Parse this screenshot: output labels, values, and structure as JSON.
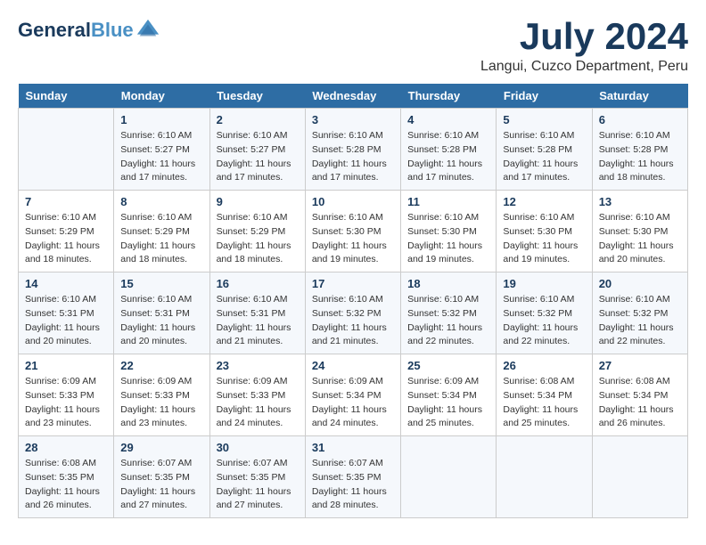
{
  "header": {
    "logo_line1": "General",
    "logo_line2": "Blue",
    "month_year": "July 2024",
    "location": "Langui, Cuzco Department, Peru"
  },
  "days_of_week": [
    "Sunday",
    "Monday",
    "Tuesday",
    "Wednesday",
    "Thursday",
    "Friday",
    "Saturday"
  ],
  "weeks": [
    [
      {
        "day": "",
        "sunrise": "",
        "sunset": "",
        "daylight": ""
      },
      {
        "day": "1",
        "sunrise": "Sunrise: 6:10 AM",
        "sunset": "Sunset: 5:27 PM",
        "daylight": "Daylight: 11 hours and 17 minutes."
      },
      {
        "day": "2",
        "sunrise": "Sunrise: 6:10 AM",
        "sunset": "Sunset: 5:27 PM",
        "daylight": "Daylight: 11 hours and 17 minutes."
      },
      {
        "day": "3",
        "sunrise": "Sunrise: 6:10 AM",
        "sunset": "Sunset: 5:28 PM",
        "daylight": "Daylight: 11 hours and 17 minutes."
      },
      {
        "day": "4",
        "sunrise": "Sunrise: 6:10 AM",
        "sunset": "Sunset: 5:28 PM",
        "daylight": "Daylight: 11 hours and 17 minutes."
      },
      {
        "day": "5",
        "sunrise": "Sunrise: 6:10 AM",
        "sunset": "Sunset: 5:28 PM",
        "daylight": "Daylight: 11 hours and 17 minutes."
      },
      {
        "day": "6",
        "sunrise": "Sunrise: 6:10 AM",
        "sunset": "Sunset: 5:28 PM",
        "daylight": "Daylight: 11 hours and 18 minutes."
      }
    ],
    [
      {
        "day": "7",
        "sunrise": "Sunrise: 6:10 AM",
        "sunset": "Sunset: 5:29 PM",
        "daylight": "Daylight: 11 hours and 18 minutes."
      },
      {
        "day": "8",
        "sunrise": "Sunrise: 6:10 AM",
        "sunset": "Sunset: 5:29 PM",
        "daylight": "Daylight: 11 hours and 18 minutes."
      },
      {
        "day": "9",
        "sunrise": "Sunrise: 6:10 AM",
        "sunset": "Sunset: 5:29 PM",
        "daylight": "Daylight: 11 hours and 18 minutes."
      },
      {
        "day": "10",
        "sunrise": "Sunrise: 6:10 AM",
        "sunset": "Sunset: 5:30 PM",
        "daylight": "Daylight: 11 hours and 19 minutes."
      },
      {
        "day": "11",
        "sunrise": "Sunrise: 6:10 AM",
        "sunset": "Sunset: 5:30 PM",
        "daylight": "Daylight: 11 hours and 19 minutes."
      },
      {
        "day": "12",
        "sunrise": "Sunrise: 6:10 AM",
        "sunset": "Sunset: 5:30 PM",
        "daylight": "Daylight: 11 hours and 19 minutes."
      },
      {
        "day": "13",
        "sunrise": "Sunrise: 6:10 AM",
        "sunset": "Sunset: 5:30 PM",
        "daylight": "Daylight: 11 hours and 20 minutes."
      }
    ],
    [
      {
        "day": "14",
        "sunrise": "Sunrise: 6:10 AM",
        "sunset": "Sunset: 5:31 PM",
        "daylight": "Daylight: 11 hours and 20 minutes."
      },
      {
        "day": "15",
        "sunrise": "Sunrise: 6:10 AM",
        "sunset": "Sunset: 5:31 PM",
        "daylight": "Daylight: 11 hours and 20 minutes."
      },
      {
        "day": "16",
        "sunrise": "Sunrise: 6:10 AM",
        "sunset": "Sunset: 5:31 PM",
        "daylight": "Daylight: 11 hours and 21 minutes."
      },
      {
        "day": "17",
        "sunrise": "Sunrise: 6:10 AM",
        "sunset": "Sunset: 5:32 PM",
        "daylight": "Daylight: 11 hours and 21 minutes."
      },
      {
        "day": "18",
        "sunrise": "Sunrise: 6:10 AM",
        "sunset": "Sunset: 5:32 PM",
        "daylight": "Daylight: 11 hours and 22 minutes."
      },
      {
        "day": "19",
        "sunrise": "Sunrise: 6:10 AM",
        "sunset": "Sunset: 5:32 PM",
        "daylight": "Daylight: 11 hours and 22 minutes."
      },
      {
        "day": "20",
        "sunrise": "Sunrise: 6:10 AM",
        "sunset": "Sunset: 5:32 PM",
        "daylight": "Daylight: 11 hours and 22 minutes."
      }
    ],
    [
      {
        "day": "21",
        "sunrise": "Sunrise: 6:09 AM",
        "sunset": "Sunset: 5:33 PM",
        "daylight": "Daylight: 11 hours and 23 minutes."
      },
      {
        "day": "22",
        "sunrise": "Sunrise: 6:09 AM",
        "sunset": "Sunset: 5:33 PM",
        "daylight": "Daylight: 11 hours and 23 minutes."
      },
      {
        "day": "23",
        "sunrise": "Sunrise: 6:09 AM",
        "sunset": "Sunset: 5:33 PM",
        "daylight": "Daylight: 11 hours and 24 minutes."
      },
      {
        "day": "24",
        "sunrise": "Sunrise: 6:09 AM",
        "sunset": "Sunset: 5:34 PM",
        "daylight": "Daylight: 11 hours and 24 minutes."
      },
      {
        "day": "25",
        "sunrise": "Sunrise: 6:09 AM",
        "sunset": "Sunset: 5:34 PM",
        "daylight": "Daylight: 11 hours and 25 minutes."
      },
      {
        "day": "26",
        "sunrise": "Sunrise: 6:08 AM",
        "sunset": "Sunset: 5:34 PM",
        "daylight": "Daylight: 11 hours and 25 minutes."
      },
      {
        "day": "27",
        "sunrise": "Sunrise: 6:08 AM",
        "sunset": "Sunset: 5:34 PM",
        "daylight": "Daylight: 11 hours and 26 minutes."
      }
    ],
    [
      {
        "day": "28",
        "sunrise": "Sunrise: 6:08 AM",
        "sunset": "Sunset: 5:35 PM",
        "daylight": "Daylight: 11 hours and 26 minutes."
      },
      {
        "day": "29",
        "sunrise": "Sunrise: 6:07 AM",
        "sunset": "Sunset: 5:35 PM",
        "daylight": "Daylight: 11 hours and 27 minutes."
      },
      {
        "day": "30",
        "sunrise": "Sunrise: 6:07 AM",
        "sunset": "Sunset: 5:35 PM",
        "daylight": "Daylight: 11 hours and 27 minutes."
      },
      {
        "day": "31",
        "sunrise": "Sunrise: 6:07 AM",
        "sunset": "Sunset: 5:35 PM",
        "daylight": "Daylight: 11 hours and 28 minutes."
      },
      {
        "day": "",
        "sunrise": "",
        "sunset": "",
        "daylight": ""
      },
      {
        "day": "",
        "sunrise": "",
        "sunset": "",
        "daylight": ""
      },
      {
        "day": "",
        "sunrise": "",
        "sunset": "",
        "daylight": ""
      }
    ]
  ]
}
